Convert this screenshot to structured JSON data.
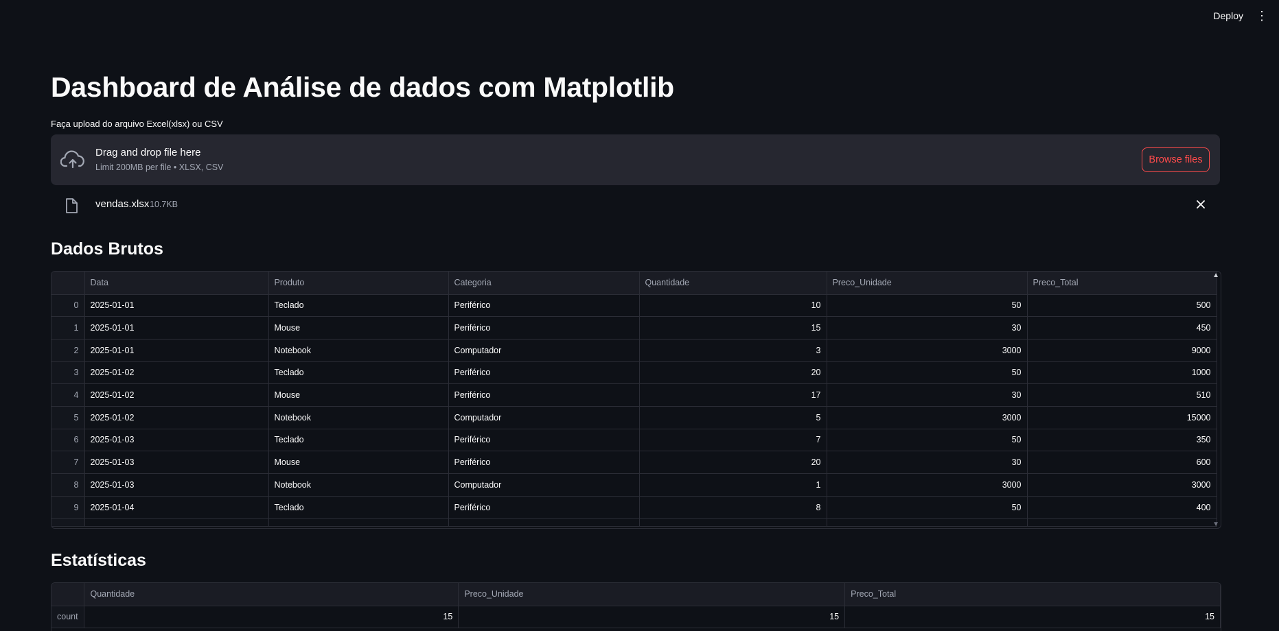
{
  "topbar": {
    "deploy_label": "Deploy",
    "menu_icon": "more-vertical-icon"
  },
  "page": {
    "title": "Dashboard de Análise de dados com Matplotlib"
  },
  "uploader": {
    "label": "Faça upload do arquivo Excel(xlsx) ou CSV",
    "drop_title": "Drag and drop file here",
    "drop_subtitle": "Limit 200MB per file • XLSX, CSV",
    "browse_label": "Browse files",
    "file": {
      "name": "vendas.xlsx",
      "size": "10.7KB"
    }
  },
  "raw": {
    "heading": "Dados Brutos",
    "columns": [
      "Data",
      "Produto",
      "Categoria",
      "Quantidade",
      "Preco_Unidade",
      "Preco_Total"
    ],
    "rows": [
      [
        "0",
        "2025-01-01",
        "Teclado",
        "Periférico",
        "10",
        "50",
        "500"
      ],
      [
        "1",
        "2025-01-01",
        "Mouse",
        "Periférico",
        "15",
        "30",
        "450"
      ],
      [
        "2",
        "2025-01-01",
        "Notebook",
        "Computador",
        "3",
        "3000",
        "9000"
      ],
      [
        "3",
        "2025-01-02",
        "Teclado",
        "Periférico",
        "20",
        "50",
        "1000"
      ],
      [
        "4",
        "2025-01-02",
        "Mouse",
        "Periférico",
        "17",
        "30",
        "510"
      ],
      [
        "5",
        "2025-01-02",
        "Notebook",
        "Computador",
        "5",
        "3000",
        "15000"
      ],
      [
        "6",
        "2025-01-03",
        "Teclado",
        "Periférico",
        "7",
        "50",
        "350"
      ],
      [
        "7",
        "2025-01-03",
        "Mouse",
        "Periférico",
        "20",
        "30",
        "600"
      ],
      [
        "8",
        "2025-01-03",
        "Notebook",
        "Computador",
        "1",
        "3000",
        "3000"
      ],
      [
        "9",
        "2025-01-04",
        "Teclado",
        "Periférico",
        "8",
        "50",
        "400"
      ]
    ]
  },
  "stats": {
    "heading": "Estatísticas",
    "columns": [
      "Quantidade",
      "Preco_Unidade",
      "Preco_Total"
    ],
    "rows": [
      [
        "count",
        "15",
        "15",
        "15"
      ]
    ]
  },
  "colors": {
    "background": "#0e1117",
    "surface": "#262730",
    "accent": "#ff4b4b",
    "muted_text": "#a3a8b4"
  }
}
